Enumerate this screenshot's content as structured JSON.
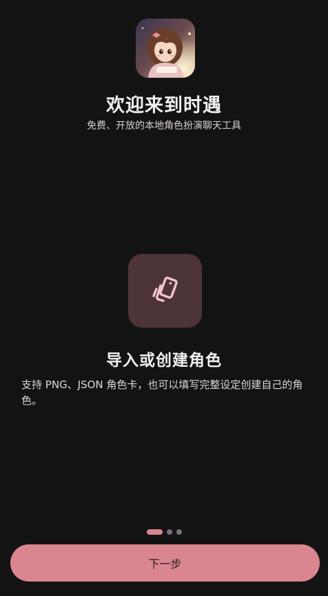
{
  "welcome": {
    "title": "欢迎来到时遇",
    "subtitle": "免费、开放的本地角色扮演聊天工具"
  },
  "feature": {
    "icon": "cards-icon",
    "title": "导入或创建角色",
    "description": "支持 PNG、JSON 角色卡，也可以填写完整设定创建自己的角色。"
  },
  "pagination": {
    "total": 3,
    "current": 1
  },
  "next_button": {
    "label": "下一步"
  },
  "colors": {
    "background": "#141314",
    "accent": "#d98690",
    "icon_tile": "#4d3438"
  }
}
